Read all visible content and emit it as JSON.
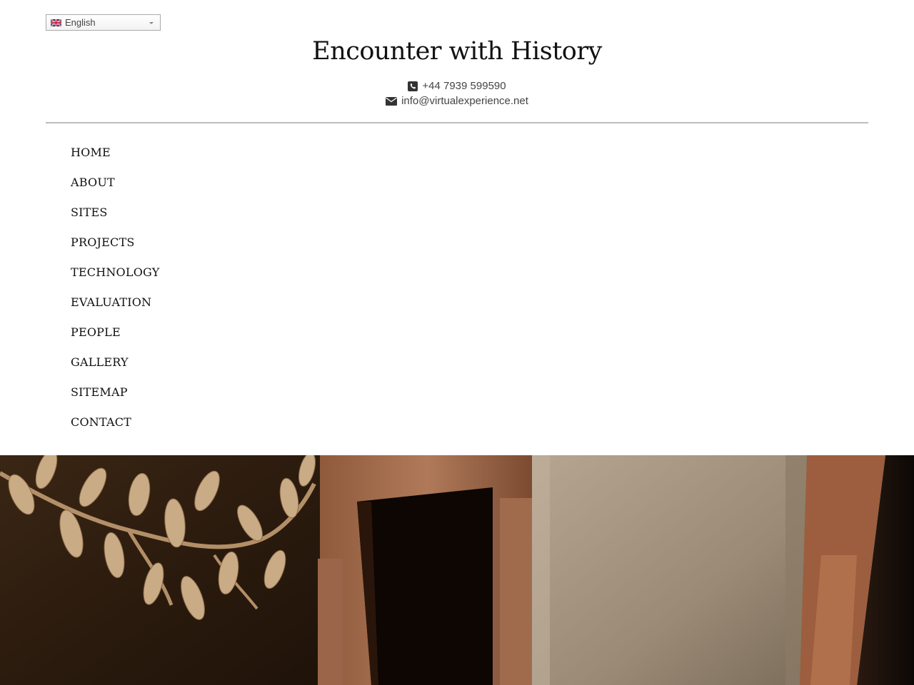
{
  "language_selector": {
    "value": "English",
    "flag_icon": "uk-flag-icon"
  },
  "header": {
    "title": "Encounter with History",
    "phone": "+44 7939 599590",
    "email": "info@virtualexperience.net",
    "phone_icon": "phone-square-icon",
    "email_icon": "envelope-icon"
  },
  "nav": {
    "items": [
      {
        "label": "HOME"
      },
      {
        "label": "ABOUT"
      },
      {
        "label": "SITES"
      },
      {
        "label": "PROJECTS"
      },
      {
        "label": "TECHNOLOGY"
      },
      {
        "label": "EVALUATION"
      },
      {
        "label": "PEOPLE"
      },
      {
        "label": "GALLERY"
      },
      {
        "label": "SITEMAP"
      },
      {
        "label": "CONTACT"
      }
    ]
  },
  "hero": {
    "image": "historic-interior-doorway-with-fresco"
  },
  "colors": {
    "text": "#111111",
    "muted": "#444444",
    "divider": "#bdbdbd"
  }
}
